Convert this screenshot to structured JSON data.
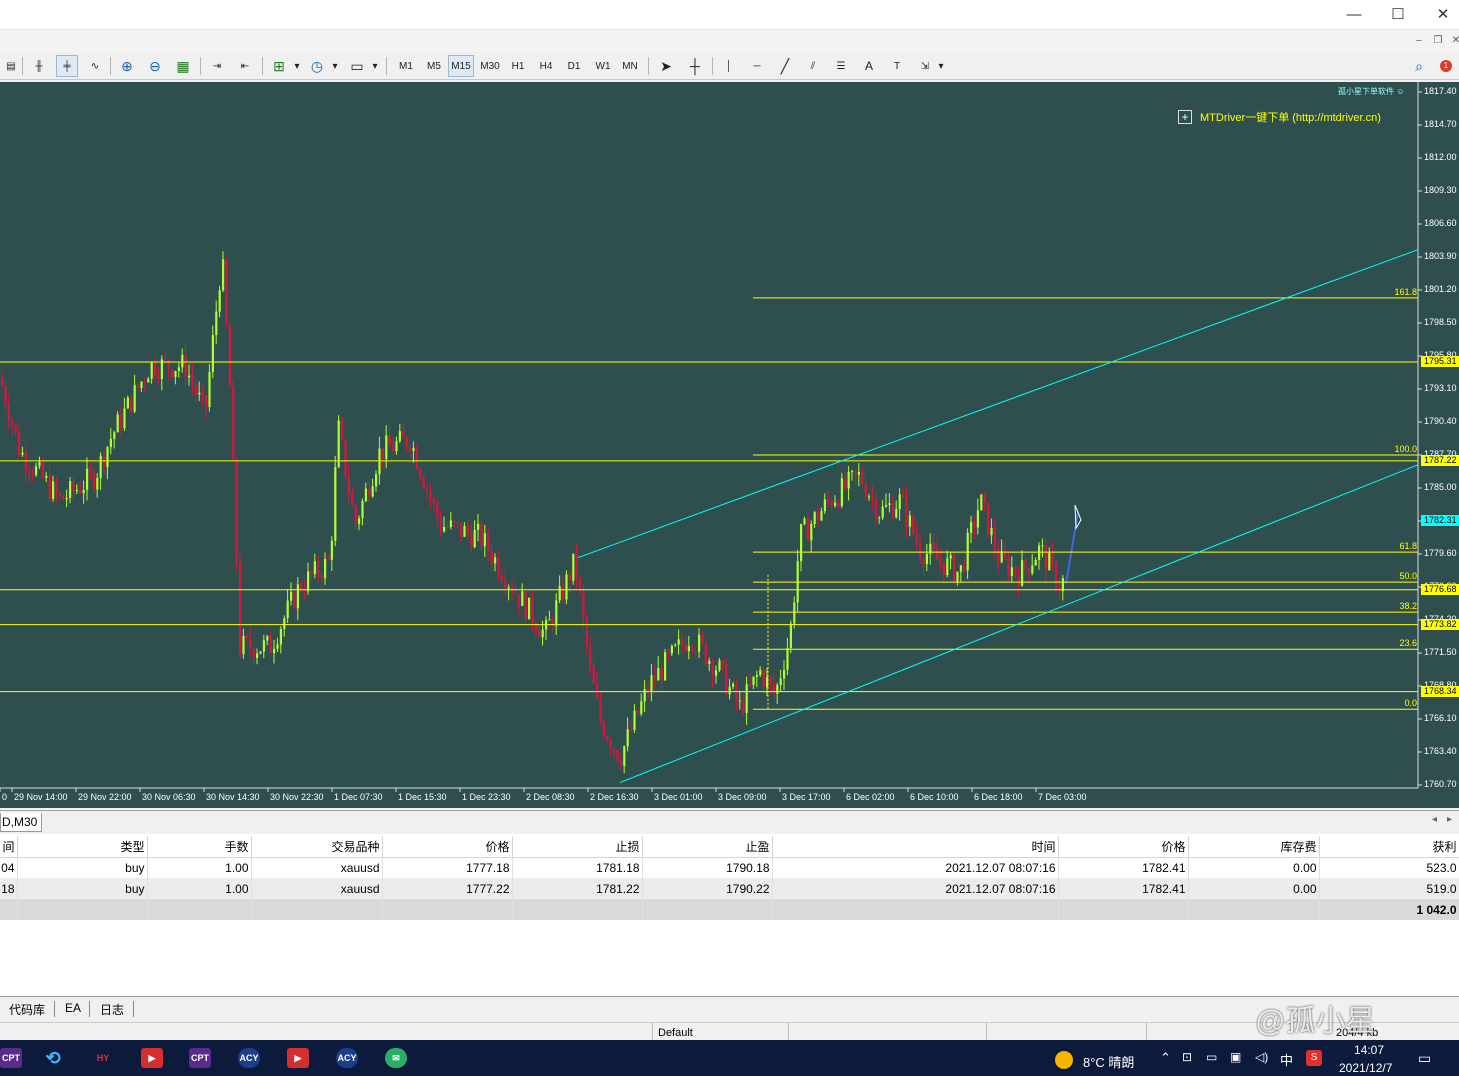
{
  "window": {
    "minimize": "—",
    "maximize": "☐",
    "close": "✕"
  },
  "toolbar": {
    "timeframes": [
      "M1",
      "M5",
      "M15",
      "M30",
      "H1",
      "H4",
      "D1",
      "W1",
      "MN"
    ],
    "active_timeframe": "M15"
  },
  "chart": {
    "top_right_label": "孤小星下单软件 ☺",
    "plugin_label": "MTDriver一键下单 (http://mtdriver.cn)",
    "price_axis": [
      "1817.40",
      "1814.70",
      "1812.00",
      "1809.30",
      "1806.60",
      "1803.90",
      "1801.20",
      "1798.50",
      "1795.80",
      "1793.10",
      "1790.40",
      "1787.70",
      "1785.00",
      "1782.30",
      "1779.60",
      "1776.90",
      "1774.20",
      "1771.50",
      "1768.80",
      "1766.10",
      "1763.40",
      "1760.70"
    ],
    "horizontal_level_tags": [
      "1795.31",
      "1787.22",
      "1776.68",
      "1773.82",
      "1768.34"
    ],
    "current_price_tag": "1782.31",
    "fibo_levels": [
      "161.8",
      "100.0",
      "61.8",
      "50.0",
      "38.2",
      "23.6",
      "0.0"
    ],
    "time_axis": [
      "0",
      "29 Nov 14:00",
      "29 Nov 22:00",
      "30 Nov 06:30",
      "30 Nov 14:30",
      "30 Nov 22:30",
      "1 Dec 07:30",
      "1 Dec 15:30",
      "1 Dec 23:30",
      "2 Dec 08:30",
      "2 Dec 16:30",
      "3 Dec 01:00",
      "3 Dec 09:00",
      "3 Dec 17:00",
      "6 Dec 02:00",
      "6 Dec 10:00",
      "6 Dec 18:00",
      "7 Dec 03:00"
    ],
    "colors": {
      "background": "#2f4f4f",
      "bull": "#adff2f",
      "bear": "#dc143c",
      "hline": "#ffff00",
      "channel": "#00ffff"
    }
  },
  "tabstrip": {
    "chart_tab": "D,M30"
  },
  "terminal": {
    "headers": [
      "间",
      "类型",
      "手数",
      "交易品种",
      "价格",
      "止损",
      "止盈",
      "时间",
      "价格",
      "库存费",
      "获利"
    ],
    "rows": [
      [
        "04",
        "buy",
        "1.00",
        "xauusd",
        "1777.18",
        "1781.18",
        "1790.18",
        "2021.12.07 08:07:16",
        "1782.41",
        "0.00",
        "523.0"
      ],
      [
        "18",
        "buy",
        "1.00",
        "xauusd",
        "1777.22",
        "1781.22",
        "1790.22",
        "2021.12.07 08:07:16",
        "1782.41",
        "0.00",
        "519.0"
      ]
    ],
    "total": "1 042.0"
  },
  "bottom_tabs": [
    "代码库",
    "EA",
    "日志"
  ],
  "statusbar": {
    "profile": "Default",
    "traffic": "204/4 kb"
  },
  "taskbar": {
    "apps": [
      "CPT",
      "HY",
      "CPT",
      "ACY",
      "ACY"
    ],
    "weather": "8°C  晴朗",
    "ime": "中",
    "time": "14:07",
    "date": "2021/12/7",
    "watermark": "@孤小星"
  }
}
